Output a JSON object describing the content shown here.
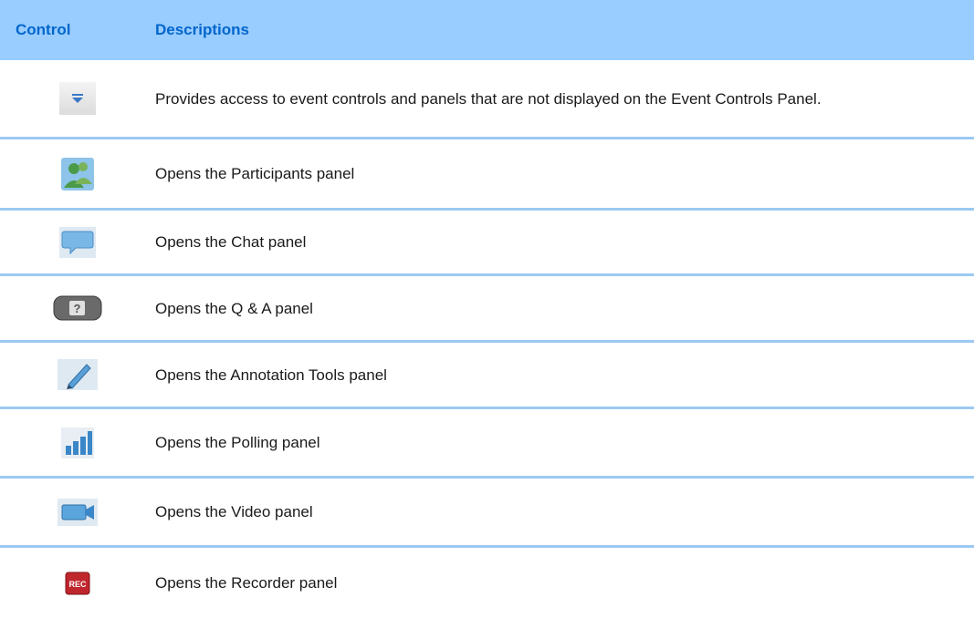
{
  "table": {
    "header": {
      "control": "Control",
      "descriptions": "Descriptions"
    },
    "rows": [
      {
        "icon": "more-controls-dropdown-icon",
        "description": "Provides access to event controls and panels that are not displayed on the Event Controls Panel."
      },
      {
        "icon": "participants-icon",
        "description": "Opens the Participants panel"
      },
      {
        "icon": "chat-icon",
        "description": "Opens the Chat panel"
      },
      {
        "icon": "qa-icon",
        "icon_text": "?",
        "description": "Opens the Q & A panel"
      },
      {
        "icon": "annotation-pencil-icon",
        "description": "Opens the Annotation Tools panel"
      },
      {
        "icon": "polling-bars-icon",
        "description": "Opens the Polling panel"
      },
      {
        "icon": "video-camera-icon",
        "description": "Opens the Video panel"
      },
      {
        "icon": "recorder-rec-icon",
        "icon_text": "REC",
        "description": "Opens the Recorder panel"
      }
    ]
  }
}
